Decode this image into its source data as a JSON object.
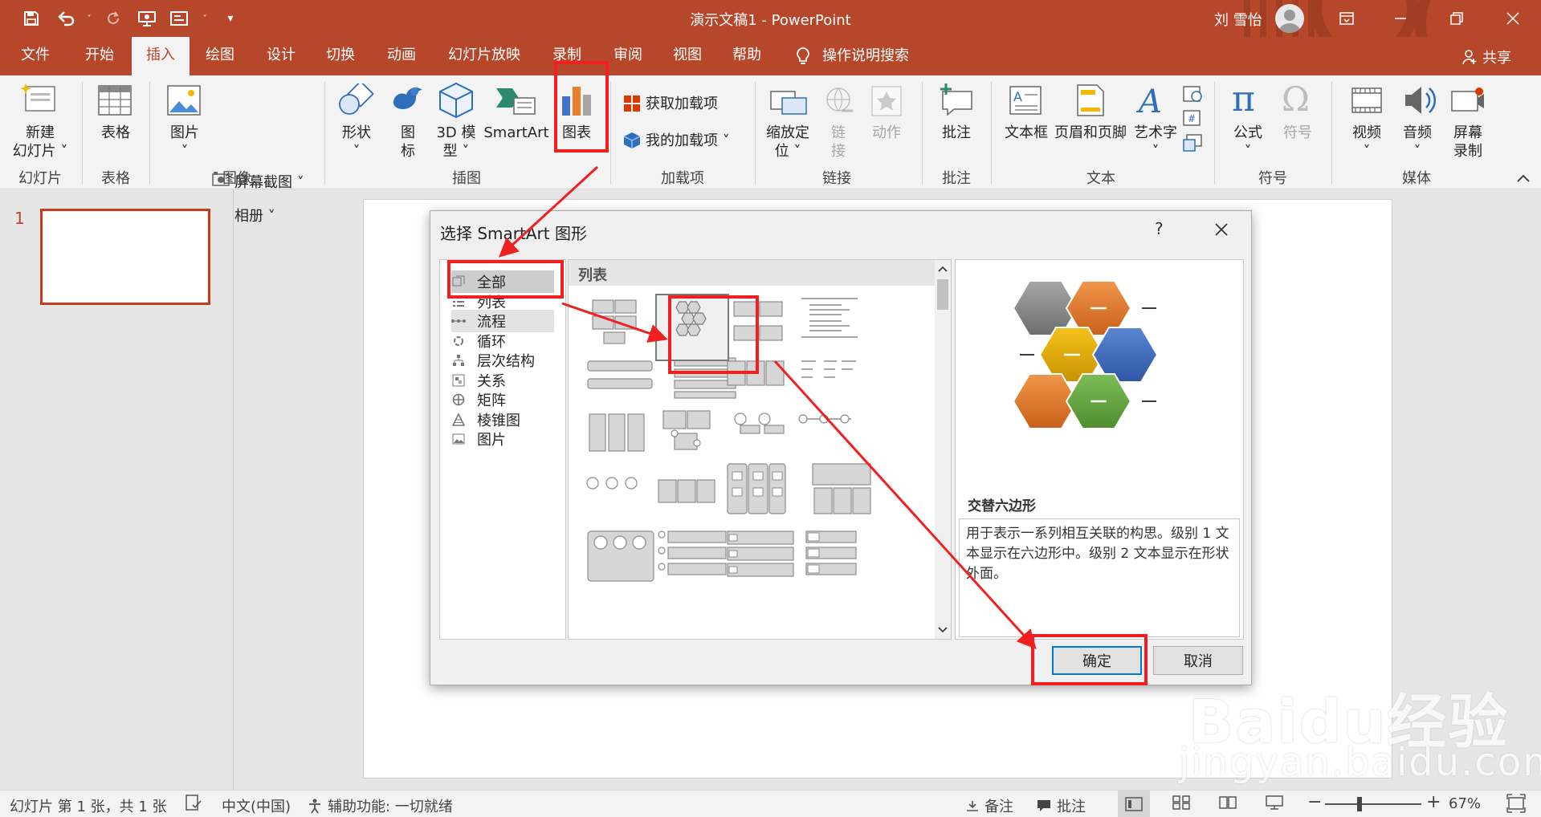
{
  "window": {
    "doc_title": "演示文稿1  -  PowerPoint",
    "user_name": "刘 雪怡"
  },
  "tabs": [
    {
      "label": "文件"
    },
    {
      "label": "开始"
    },
    {
      "label": "插入",
      "active": true
    },
    {
      "label": "绘图"
    },
    {
      "label": "设计"
    },
    {
      "label": "切换"
    },
    {
      "label": "动画"
    },
    {
      "label": "幻灯片放映"
    },
    {
      "label": "录制"
    },
    {
      "label": "审阅"
    },
    {
      "label": "视图"
    },
    {
      "label": "帮助"
    },
    {
      "label": "操作说明搜索"
    }
  ],
  "share_label": "共享",
  "ribbon": {
    "new_slide": "新建\n幻灯片 ˅",
    "table": "表格",
    "picture": "图片",
    "screenshot": "屏幕截图 ˅",
    "album": "相册  ˅",
    "shapes": "形状",
    "icons": "图\n标",
    "model3d": "3D 模\n型 ˅",
    "smartart": "SmartArt",
    "chart": "图表",
    "get_addins": "获取加载项",
    "my_addins": "我的加载项  ˅",
    "zoom": "缩放定\n位 ˅",
    "link": "链\n接",
    "action": "动作",
    "comment": "批注",
    "textbox": "文本框",
    "header_footer": "页眉和页脚",
    "wordart": "艺术字",
    "equation": "公式",
    "symbol": "符号",
    "video": "视频",
    "audio": "音频",
    "screen_record": "屏幕\n录制",
    "groups": {
      "slides": "幻灯片",
      "tables": "表格",
      "images": "图像",
      "illustrations": "插图",
      "addins": "加载项",
      "links": "链接",
      "comments": "批注",
      "text": "文本",
      "symbols": "符号",
      "media": "媒体"
    }
  },
  "slides_panel": {
    "slide_number": "1"
  },
  "dialog": {
    "title": "选择 SmartArt 图形",
    "help": "?",
    "categories": [
      "全部",
      "列表",
      "流程",
      "循环",
      "层次结构",
      "关系",
      "矩阵",
      "棱锥图",
      "图片"
    ],
    "selected_category": "全部",
    "gallery_header": "列表",
    "preview_name": "交替六边形",
    "preview_description": "用于表示一系列相互关联的构思。级别 1 文本显示在六边形中。级别 2 文本显示在形状外面。",
    "ok_label": "确定",
    "cancel_label": "取消",
    "hex_colors": [
      "#8c8c8c",
      "#e07b2c",
      "#e3aa0c",
      "#3e6bbf",
      "#e07b2c",
      "#6aa444"
    ]
  },
  "status": {
    "slide_info": "幻灯片 第 1 张，共 1 张",
    "language": "中文(中国)",
    "accessibility": "辅助功能: 一切就绪",
    "notes": "备注",
    "comments": "批注",
    "zoom": "67%"
  },
  "watermark": {
    "brand": "Baidu经验",
    "url": "jingyan.baidu.com"
  },
  "colors": {
    "accent": "#b7472a",
    "annotation": "#f02020"
  }
}
